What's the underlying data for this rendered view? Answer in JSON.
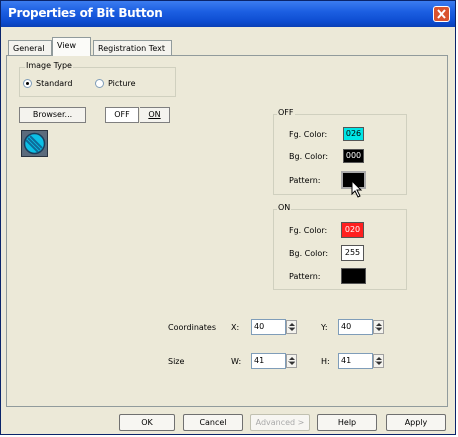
{
  "window": {
    "title": "Properties of Bit Button"
  },
  "tabs": [
    {
      "label": "General",
      "active": false
    },
    {
      "label": "View",
      "active": true
    },
    {
      "label": "Registration Text",
      "active": false
    }
  ],
  "image_type": {
    "legend": "Image Type",
    "options": [
      {
        "label": "Standard",
        "selected": true
      },
      {
        "label": "Picture",
        "selected": false
      }
    ]
  },
  "browser_button": "Browser...",
  "state_buttons": {
    "off": "OFF",
    "on": "ON"
  },
  "off_group": {
    "legend": "OFF",
    "fg_label": "Fg. Color:",
    "fg_value": "026",
    "fg_color": "#00e5e5",
    "bg_label": "Bg. Color:",
    "bg_value": "000",
    "bg_color": "#000000",
    "pattern_label": "Pattern:"
  },
  "on_group": {
    "legend": "ON",
    "fg_label": "Fg. Color:",
    "fg_value": "020",
    "fg_color": "#ff2020",
    "bg_label": "Bg. Color:",
    "bg_value": "255",
    "bg_color": "#ffffff",
    "pattern_label": "Pattern:"
  },
  "coordinates": {
    "label": "Coordinates",
    "x_label": "X:",
    "x_value": "40",
    "y_label": "Y:",
    "y_value": "40"
  },
  "size": {
    "label": "Size",
    "w_label": "W:",
    "w_value": "41",
    "h_label": "H:",
    "h_value": "41"
  },
  "buttons": {
    "ok": "OK",
    "cancel": "Cancel",
    "advanced": "Advanced >",
    "help": "Help",
    "apply": "Apply"
  }
}
